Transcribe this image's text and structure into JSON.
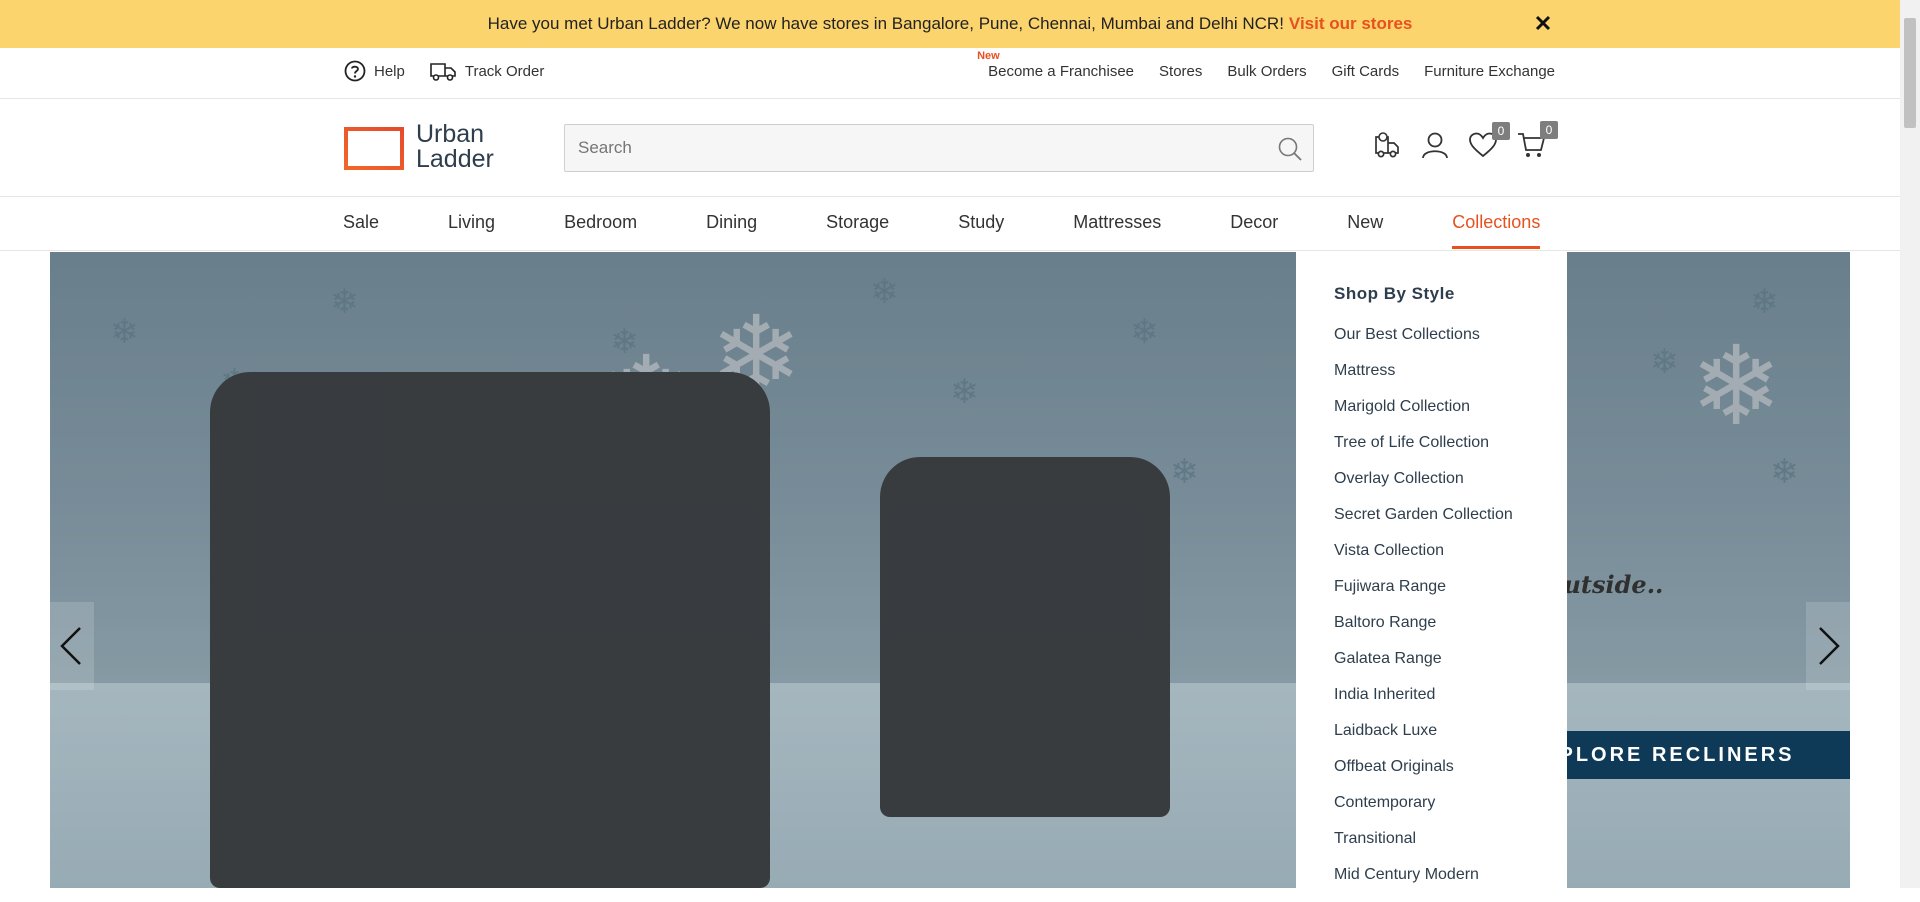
{
  "promo": {
    "message": "Have you met Urban Ladder? We now have stores in Bangalore, Pune, Chennai, Mumbai and Delhi NCR!",
    "link": "Visit our stores"
  },
  "utility": {
    "help": "Help",
    "track_order": "Track Order",
    "new_tag": "New",
    "right_links": [
      "Become a Franchisee",
      "Stores",
      "Bulk Orders",
      "Gift Cards",
      "Furniture Exchange"
    ]
  },
  "header": {
    "logo_line1": "Urban",
    "logo_line2": "Ladder",
    "search_placeholder": "Search",
    "wishlist_count": "0",
    "cart_count": "0"
  },
  "nav": {
    "items": [
      "Sale",
      "Living",
      "Bedroom",
      "Dining",
      "Storage",
      "Study",
      "Mattresses",
      "Decor",
      "New",
      "Collections"
    ]
  },
  "hero": {
    "tagline": "l outside..",
    "cta": "PLORE RECLINERS"
  },
  "dropdown": {
    "title": "Shop By Style",
    "items": [
      "Our Best Collections",
      "Mattress",
      "Marigold Collection",
      "Tree of Life Collection",
      "Overlay Collection",
      "Secret Garden Collection",
      "Vista Collection",
      "Fujiwara Range",
      "Baltoro Range",
      "Galatea Range",
      "India Inherited",
      "Laidback Luxe",
      "Offbeat Originals",
      "Contemporary",
      "Transitional",
      "Mid Century Modern"
    ]
  },
  "colors": {
    "accent": "#e7511e",
    "banner": "#fcd46d",
    "navy": "#2e3e4d",
    "cta": "#0f3a57"
  }
}
